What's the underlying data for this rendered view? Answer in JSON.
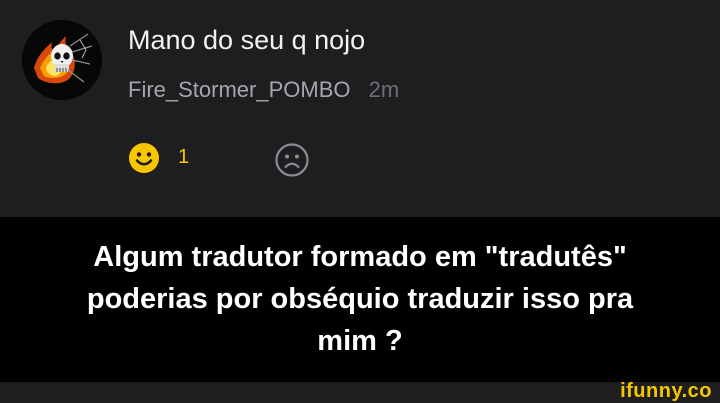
{
  "comment": {
    "text": "Mano do seu q nojo",
    "username": "Fire_Stormer_POMBO",
    "time": "2m",
    "smile_count": "1"
  },
  "caption": {
    "lines": [
      "Algum tradutor formado em \"tradutês\"",
      "poderias por obséquio traduzir isso pra",
      "mim ?"
    ]
  },
  "watermark": "ifunny.co",
  "icons": {
    "avatar": "flaming-skull-avatar",
    "smile": "smile-icon",
    "unsmile": "unsmile-icon"
  },
  "colors": {
    "panel": "#1e1e21",
    "caption_bg": "#000000",
    "accent_yellow": "#f7c600",
    "username_gray": "#a6a6ab"
  }
}
